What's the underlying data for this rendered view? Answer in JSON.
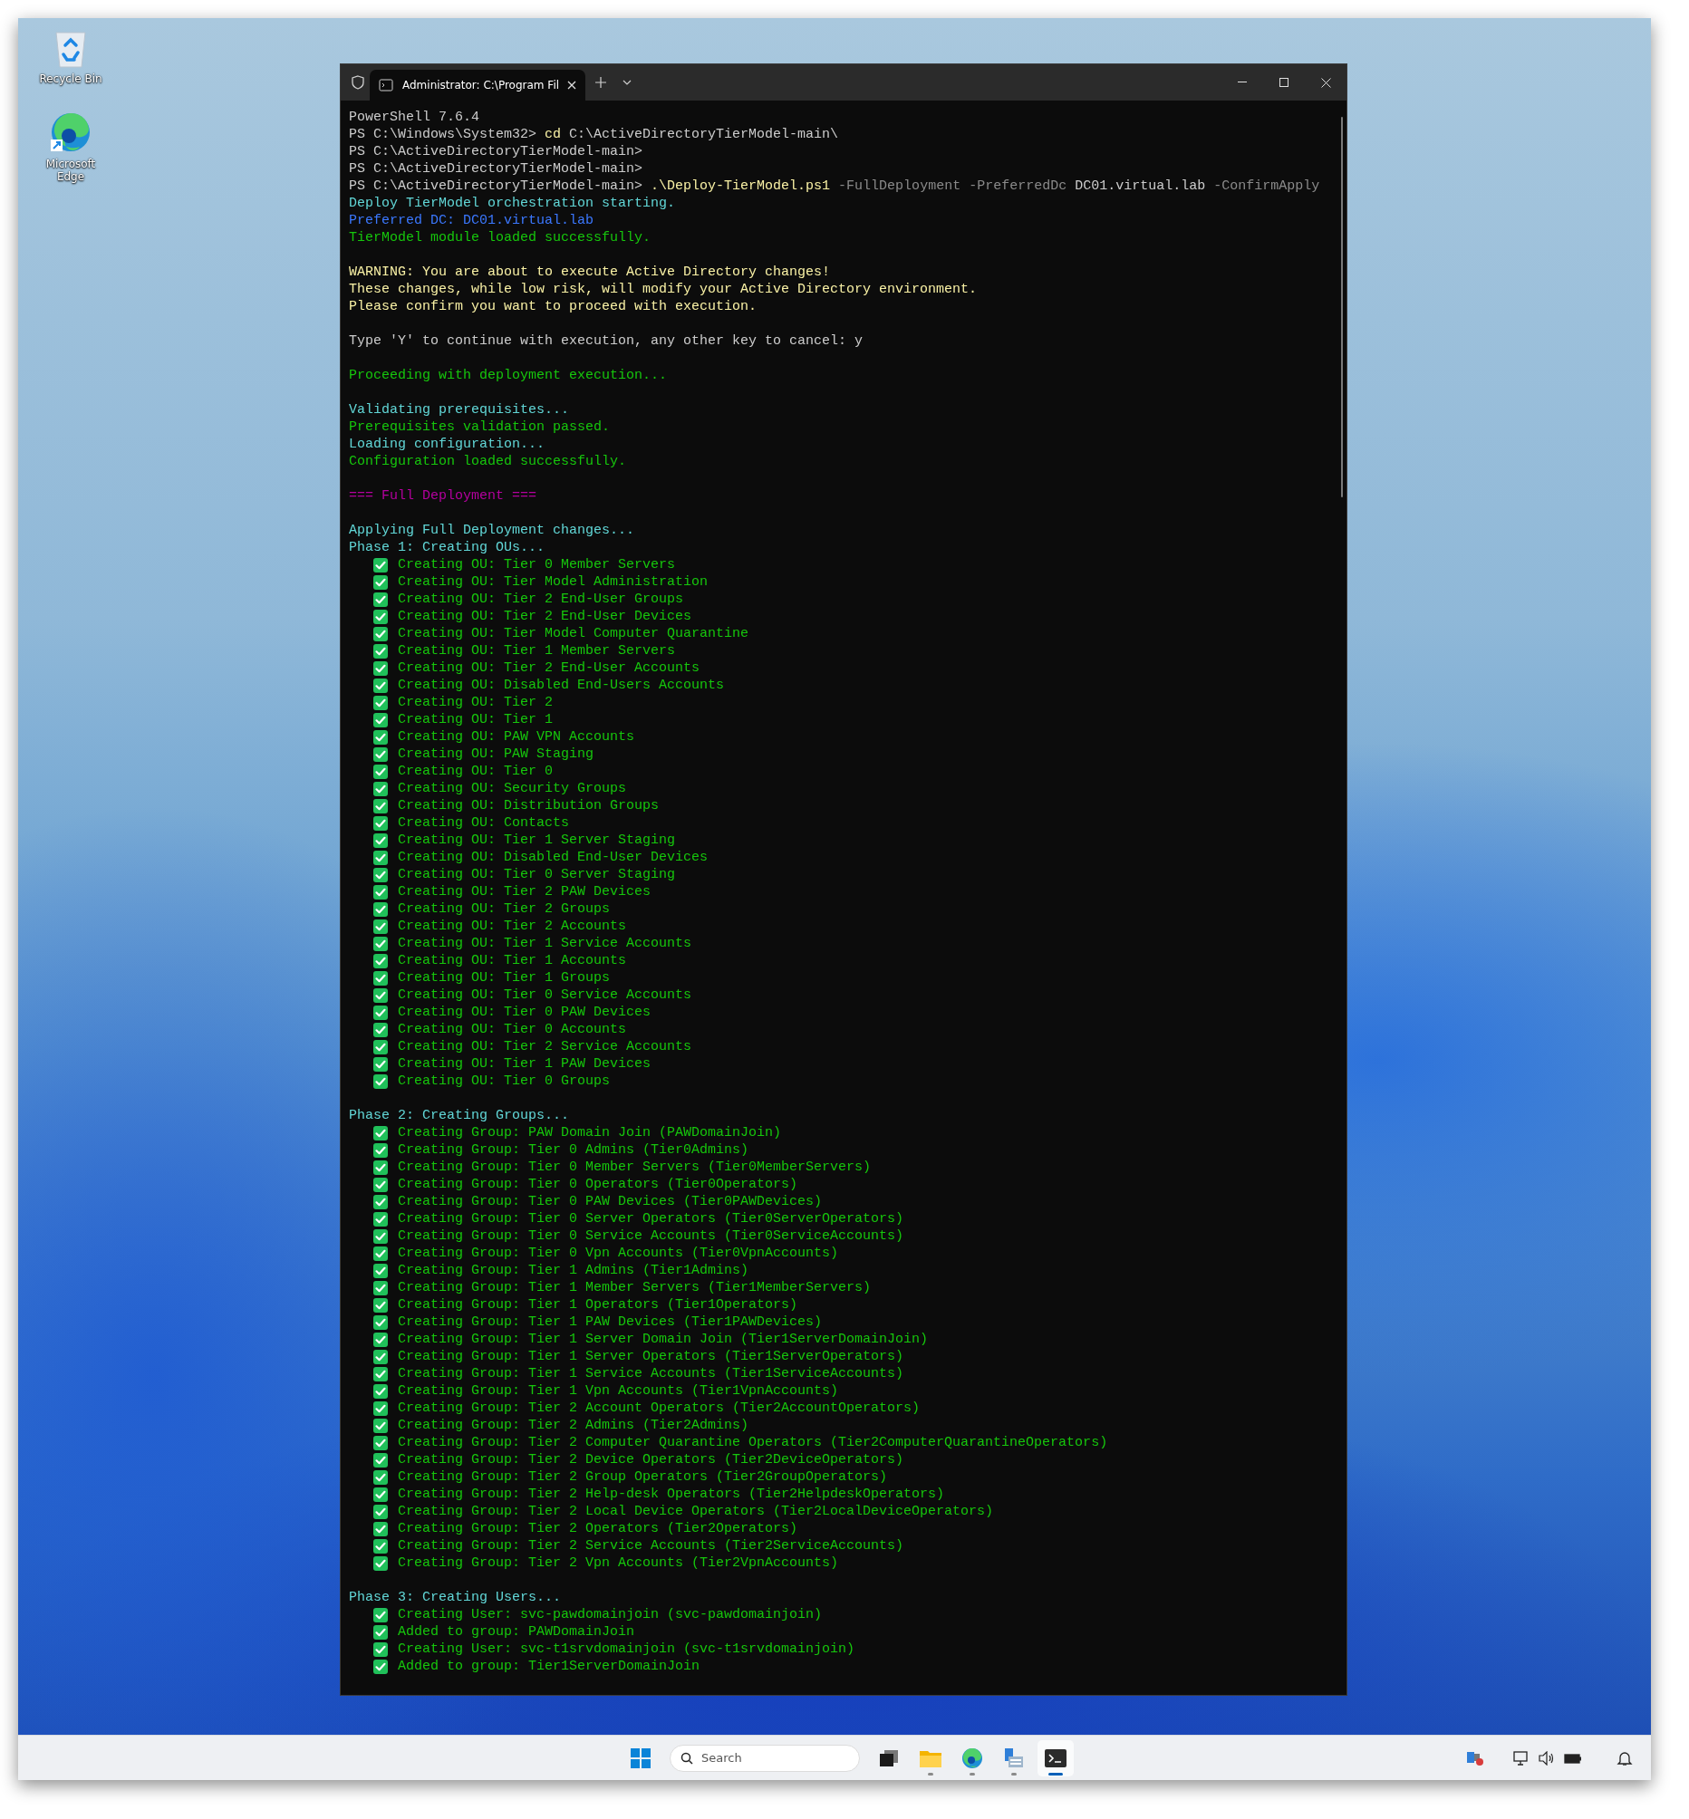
{
  "desktop_icons": [
    {
      "kind": "recycle-bin",
      "label": "Recycle Bin"
    },
    {
      "kind": "browser",
      "label": "Microsoft Edge"
    }
  ],
  "terminal": {
    "tab_title": "Administrator: C:\\Program Fil",
    "lines": [
      {
        "kind": "text",
        "color": "#cccccc",
        "text": "PowerShell 7.6.4"
      },
      {
        "kind": "mixed",
        "parts": [
          {
            "color": "#cccccc",
            "text": "PS C:\\Windows\\System32> "
          },
          {
            "color": "#f9f1a5",
            "text": "cd"
          },
          {
            "color": "#cccccc",
            "text": " C:\\ActiveDirectoryTierModel-main\\"
          }
        ]
      },
      {
        "kind": "text",
        "color": "#cccccc",
        "text": "PS C:\\ActiveDirectoryTierModel-main>"
      },
      {
        "kind": "text",
        "color": "#cccccc",
        "text": "PS C:\\ActiveDirectoryTierModel-main>"
      },
      {
        "kind": "mixed",
        "parts": [
          {
            "color": "#cccccc",
            "text": "PS C:\\ActiveDirectoryTierModel-main> "
          },
          {
            "color": "#f9f1a5",
            "text": ".\\Deploy-TierModel.ps1"
          },
          {
            "color": "#8a8a8a",
            "text": " -FullDeployment -PreferredDc"
          },
          {
            "color": "#cccccc",
            "text": " DC01.virtual.lab"
          },
          {
            "color": "#8a8a8a",
            "text": " -ConfirmApply"
          }
        ]
      },
      {
        "kind": "text",
        "color": "#61d6d6",
        "text": "Deploy TierModel orchestration starting."
      },
      {
        "kind": "text",
        "color": "#3b78ff",
        "text": "Preferred DC: DC01.virtual.lab"
      },
      {
        "kind": "text",
        "color": "#16c60c",
        "text": "TierModel module loaded successfully."
      },
      {
        "kind": "blank"
      },
      {
        "kind": "text",
        "color": "#f9f1a5",
        "text": "WARNING: You are about to execute Active Directory changes!"
      },
      {
        "kind": "text",
        "color": "#f9f1a5",
        "text": "These changes, while low risk, will modify your Active Directory environment."
      },
      {
        "kind": "text",
        "color": "#f9f1a5",
        "text": "Please confirm you want to proceed with execution."
      },
      {
        "kind": "blank"
      },
      {
        "kind": "text",
        "color": "#cccccc",
        "text": "Type 'Y' to continue with execution, any other key to cancel: y"
      },
      {
        "kind": "blank"
      },
      {
        "kind": "text",
        "color": "#16c60c",
        "text": "Proceeding with deployment execution..."
      },
      {
        "kind": "blank"
      },
      {
        "kind": "text",
        "color": "#61d6d6",
        "text": "Validating prerequisites..."
      },
      {
        "kind": "text",
        "color": "#16c60c",
        "text": "Prerequisites validation passed."
      },
      {
        "kind": "text",
        "color": "#61d6d6",
        "text": "Loading configuration..."
      },
      {
        "kind": "text",
        "color": "#16c60c",
        "text": "Configuration loaded successfully."
      },
      {
        "kind": "blank"
      },
      {
        "kind": "text",
        "color": "#b4009e",
        "text": "=== Full Deployment ==="
      },
      {
        "kind": "blank"
      },
      {
        "kind": "text",
        "color": "#61d6d6",
        "text": "Applying Full Deployment changes..."
      },
      {
        "kind": "text",
        "color": "#61d6d6",
        "text": "Phase 1: Creating OUs..."
      },
      {
        "kind": "check",
        "text": "Creating OU: Tier 0 Member Servers"
      },
      {
        "kind": "check",
        "text": "Creating OU: Tier Model Administration"
      },
      {
        "kind": "check",
        "text": "Creating OU: Tier 2 End-User Groups"
      },
      {
        "kind": "check",
        "text": "Creating OU: Tier 2 End-User Devices"
      },
      {
        "kind": "check",
        "text": "Creating OU: Tier Model Computer Quarantine"
      },
      {
        "kind": "check",
        "text": "Creating OU: Tier 1 Member Servers"
      },
      {
        "kind": "check",
        "text": "Creating OU: Tier 2 End-User Accounts"
      },
      {
        "kind": "check",
        "text": "Creating OU: Disabled End-Users Accounts"
      },
      {
        "kind": "check",
        "text": "Creating OU: Tier 2"
      },
      {
        "kind": "check",
        "text": "Creating OU: Tier 1"
      },
      {
        "kind": "check",
        "text": "Creating OU: PAW VPN Accounts"
      },
      {
        "kind": "check",
        "text": "Creating OU: PAW Staging"
      },
      {
        "kind": "check",
        "text": "Creating OU: Tier 0"
      },
      {
        "kind": "check",
        "text": "Creating OU: Security Groups"
      },
      {
        "kind": "check",
        "text": "Creating OU: Distribution Groups"
      },
      {
        "kind": "check",
        "text": "Creating OU: Contacts"
      },
      {
        "kind": "check",
        "text": "Creating OU: Tier 1 Server Staging"
      },
      {
        "kind": "check",
        "text": "Creating OU: Disabled End-User Devices"
      },
      {
        "kind": "check",
        "text": "Creating OU: Tier 0 Server Staging"
      },
      {
        "kind": "check",
        "text": "Creating OU: Tier 2 PAW Devices"
      },
      {
        "kind": "check",
        "text": "Creating OU: Tier 2 Groups"
      },
      {
        "kind": "check",
        "text": "Creating OU: Tier 2 Accounts"
      },
      {
        "kind": "check",
        "text": "Creating OU: Tier 1 Service Accounts"
      },
      {
        "kind": "check",
        "text": "Creating OU: Tier 1 Accounts"
      },
      {
        "kind": "check",
        "text": "Creating OU: Tier 1 Groups"
      },
      {
        "kind": "check",
        "text": "Creating OU: Tier 0 Service Accounts"
      },
      {
        "kind": "check",
        "text": "Creating OU: Tier 0 PAW Devices"
      },
      {
        "kind": "check",
        "text": "Creating OU: Tier 0 Accounts"
      },
      {
        "kind": "check",
        "text": "Creating OU: Tier 2 Service Accounts"
      },
      {
        "kind": "check",
        "text": "Creating OU: Tier 1 PAW Devices"
      },
      {
        "kind": "check",
        "text": "Creating OU: Tier 0 Groups"
      },
      {
        "kind": "blank"
      },
      {
        "kind": "text",
        "color": "#61d6d6",
        "text": "Phase 2: Creating Groups..."
      },
      {
        "kind": "check",
        "text": "Creating Group: PAW Domain Join (PAWDomainJoin)"
      },
      {
        "kind": "check",
        "text": "Creating Group: Tier 0 Admins (Tier0Admins)"
      },
      {
        "kind": "check",
        "text": "Creating Group: Tier 0 Member Servers (Tier0MemberServers)"
      },
      {
        "kind": "check",
        "text": "Creating Group: Tier 0 Operators (Tier0Operators)"
      },
      {
        "kind": "check",
        "text": "Creating Group: Tier 0 PAW Devices (Tier0PAWDevices)"
      },
      {
        "kind": "check",
        "text": "Creating Group: Tier 0 Server Operators (Tier0ServerOperators)"
      },
      {
        "kind": "check",
        "text": "Creating Group: Tier 0 Service Accounts (Tier0ServiceAccounts)"
      },
      {
        "kind": "check",
        "text": "Creating Group: Tier 0 Vpn Accounts (Tier0VpnAccounts)"
      },
      {
        "kind": "check",
        "text": "Creating Group: Tier 1 Admins (Tier1Admins)"
      },
      {
        "kind": "check",
        "text": "Creating Group: Tier 1 Member Servers (Tier1MemberServers)"
      },
      {
        "kind": "check",
        "text": "Creating Group: Tier 1 Operators (Tier1Operators)"
      },
      {
        "kind": "check",
        "text": "Creating Group: Tier 1 PAW Devices (Tier1PAWDevices)"
      },
      {
        "kind": "check",
        "text": "Creating Group: Tier 1 Server Domain Join (Tier1ServerDomainJoin)"
      },
      {
        "kind": "check",
        "text": "Creating Group: Tier 1 Server Operators (Tier1ServerOperators)"
      },
      {
        "kind": "check",
        "text": "Creating Group: Tier 1 Service Accounts (Tier1ServiceAccounts)"
      },
      {
        "kind": "check",
        "text": "Creating Group: Tier 1 Vpn Accounts (Tier1VpnAccounts)"
      },
      {
        "kind": "check",
        "text": "Creating Group: Tier 2 Account Operators (Tier2AccountOperators)"
      },
      {
        "kind": "check",
        "text": "Creating Group: Tier 2 Admins (Tier2Admins)"
      },
      {
        "kind": "check",
        "text": "Creating Group: Tier 2 Computer Quarantine Operators (Tier2ComputerQuarantineOperators)"
      },
      {
        "kind": "check",
        "text": "Creating Group: Tier 2 Device Operators (Tier2DeviceOperators)"
      },
      {
        "kind": "check",
        "text": "Creating Group: Tier 2 Group Operators (Tier2GroupOperators)"
      },
      {
        "kind": "check",
        "text": "Creating Group: Tier 2 Help-desk Operators (Tier2HelpdeskOperators)"
      },
      {
        "kind": "check",
        "text": "Creating Group: Tier 2 Local Device Operators (Tier2LocalDeviceOperators)"
      },
      {
        "kind": "check",
        "text": "Creating Group: Tier 2 Operators (Tier2Operators)"
      },
      {
        "kind": "check",
        "text": "Creating Group: Tier 2 Service Accounts (Tier2ServiceAccounts)"
      },
      {
        "kind": "check",
        "text": "Creating Group: Tier 2 Vpn Accounts (Tier2VpnAccounts)"
      },
      {
        "kind": "blank"
      },
      {
        "kind": "text",
        "color": "#61d6d6",
        "text": "Phase 3: Creating Users..."
      },
      {
        "kind": "check",
        "text": "Creating User: svc-pawdomainjoin (svc-pawdomainjoin)"
      },
      {
        "kind": "check",
        "text": "Added to group: PAWDomainJoin"
      },
      {
        "kind": "check",
        "text": "Creating User: svc-t1srvdomainjoin (svc-t1srvdomainjoin)"
      },
      {
        "kind": "check",
        "text": "Added to group: Tier1ServerDomainJoin"
      }
    ]
  },
  "taskbar": {
    "search": {
      "placeholder": "Search"
    }
  }
}
